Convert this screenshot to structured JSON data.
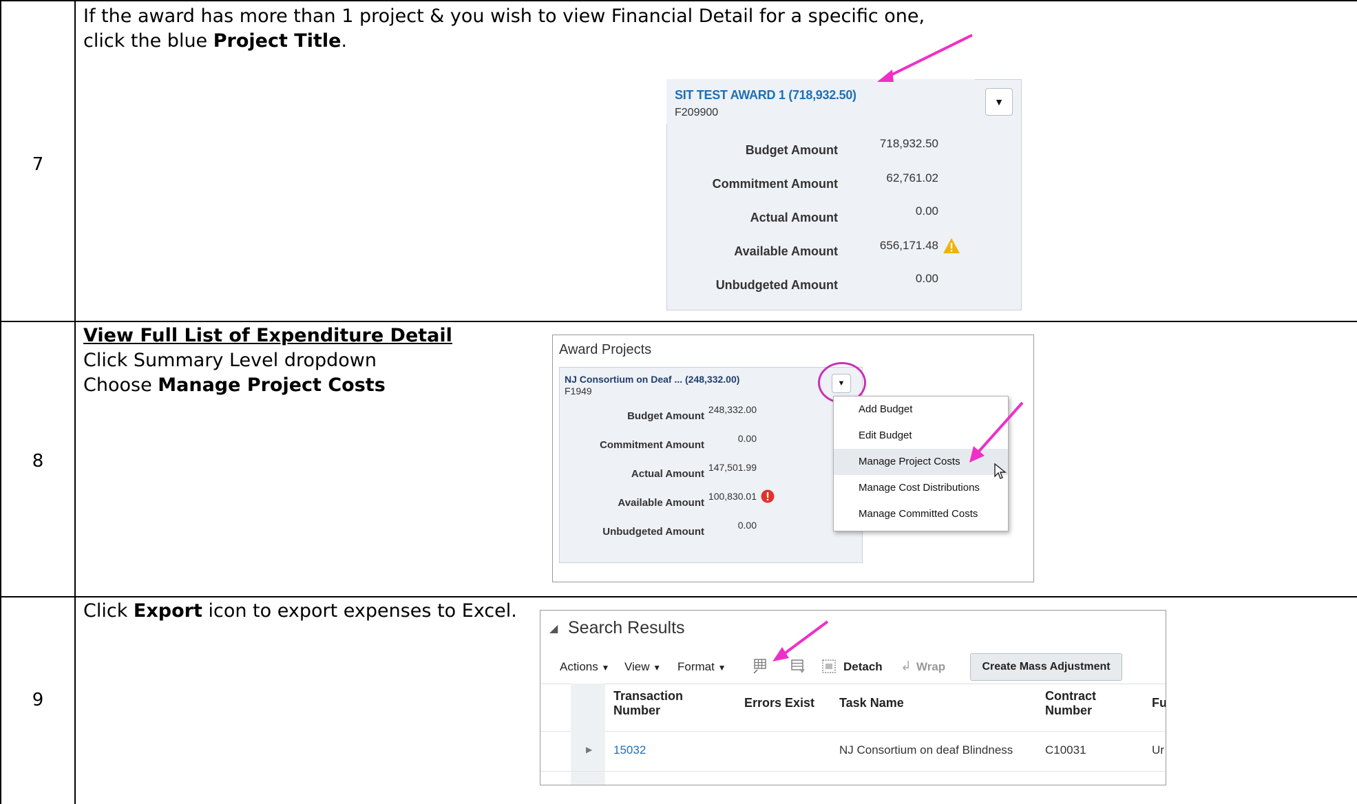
{
  "rows": [
    {
      "step": "7"
    },
    {
      "step": "8"
    },
    {
      "step": "9"
    }
  ],
  "step7": {
    "line1": "If the award has more than 1 project & you wish to view Financial Detail for a specific one,",
    "line2_pre": "click the blue ",
    "line2_bold": "Project Title",
    "line2_post": ".",
    "card": {
      "title": "SIT TEST AWARD 1 (718,932.50)",
      "code": "F209900",
      "labels": [
        "Budget Amount",
        "Commitment Amount",
        "Actual Amount",
        "Available Amount",
        "Unbudgeted Amount"
      ],
      "values": [
        "718,932.50",
        "62,761.02",
        "0.00",
        "656,171.48",
        "0.00"
      ]
    }
  },
  "step8": {
    "heading": "View Full List of Expenditure Detail",
    "line2": "Click Summary Level dropdown",
    "line3_pre": "Choose ",
    "line3_bold": "Manage Project Costs",
    "panel_title": "Award Projects",
    "card": {
      "title": "NJ Consortium on Deaf ... (248,332.00)",
      "code": "F1949",
      "labels": [
        "Budget Amount",
        "Commitment Amount",
        "Actual Amount",
        "Available Amount",
        "Unbudgeted Amount"
      ],
      "values": [
        "248,332.00",
        "0.00",
        "147,501.99",
        "100,830.01",
        "0.00"
      ]
    },
    "menu": [
      "Add Budget",
      "Edit Budget",
      "Manage Project Costs",
      "Manage Cost Distributions",
      "Manage Committed Costs"
    ]
  },
  "step9": {
    "pre": "Click ",
    "bold": "Export",
    "post": " icon to export expenses to Excel.",
    "panel_title": "Search Results",
    "toolbar": {
      "actions": "Actions",
      "view": "View",
      "format": "Format",
      "detach": "Detach",
      "wrap": "Wrap",
      "create": "Create Mass Adjustment"
    },
    "columns": [
      "Transaction Number",
      "Errors Exist",
      "Task Name",
      "Contract Number",
      "Fu"
    ],
    "row": {
      "transaction": "15032",
      "errors": "",
      "task": "NJ Consortium on deaf Blindness",
      "contract": "C10031",
      "fu": "Ur"
    }
  },
  "colors": {
    "link": "#1e6fb8",
    "arrow": "#ee2fc8",
    "warning": "#f0b400",
    "error": "#e0332b"
  }
}
